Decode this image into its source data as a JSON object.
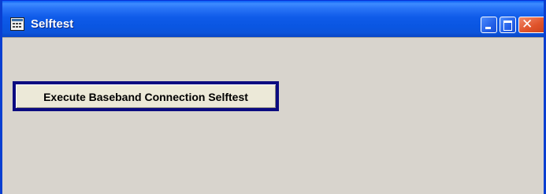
{
  "window": {
    "title": "Selftest",
    "icon": "calculator-window-icon",
    "controls": {
      "minimize": "minimize-icon",
      "maximize": "maximize-icon",
      "close_glyph": "✕"
    }
  },
  "main": {
    "execute_button_label": "Execute Baseband Connection Selftest"
  },
  "colors": {
    "titlebar": "#0a56e2",
    "client": "#d8d4cd",
    "button_face": "#ece9d8",
    "button_focus_border": "#0b0b80",
    "close_button": "#e0532a"
  }
}
